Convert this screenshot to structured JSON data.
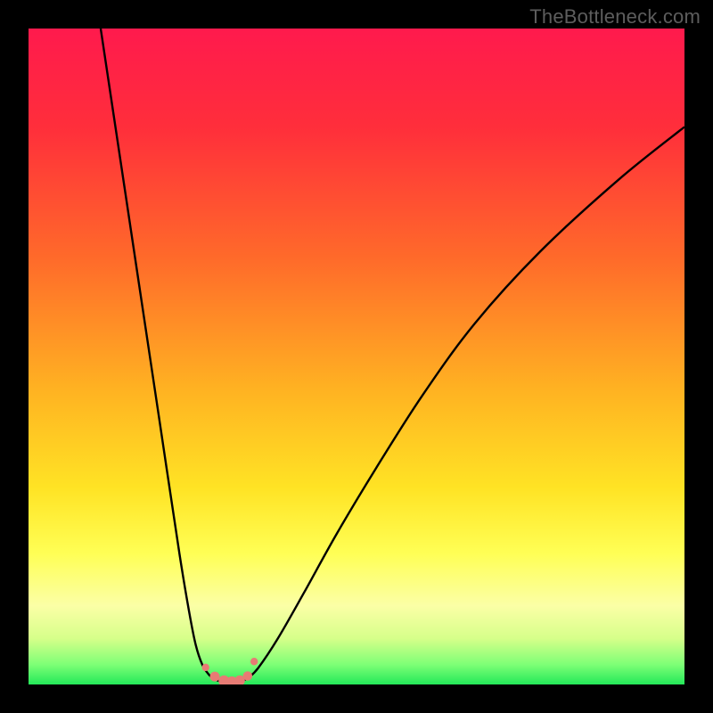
{
  "watermark": "TheBottleneck.com",
  "colors": {
    "frame": "#000000",
    "gradient_stops": [
      {
        "offset": 0.0,
        "color": "#ff1a4d"
      },
      {
        "offset": 0.15,
        "color": "#ff2e3b"
      },
      {
        "offset": 0.35,
        "color": "#ff6a2a"
      },
      {
        "offset": 0.55,
        "color": "#ffb222"
      },
      {
        "offset": 0.7,
        "color": "#ffe324"
      },
      {
        "offset": 0.8,
        "color": "#ffff55"
      },
      {
        "offset": 0.88,
        "color": "#fbffa6"
      },
      {
        "offset": 0.93,
        "color": "#d6ff8a"
      },
      {
        "offset": 0.97,
        "color": "#7dff76"
      },
      {
        "offset": 1.0,
        "color": "#24e859"
      }
    ],
    "curve": "#000000",
    "marker_fill": "#e77b74",
    "marker_stroke": "#d9645c"
  },
  "chart_data": {
    "type": "line",
    "title": "",
    "xlabel": "",
    "ylabel": "",
    "xlim": [
      0,
      100
    ],
    "ylim": [
      0,
      100
    ],
    "series": [
      {
        "name": "left-branch",
        "x": [
          11,
          14,
          17,
          20,
          23,
          24.5,
          25.5,
          26.5,
          27.5,
          28.3
        ],
        "y": [
          100,
          80,
          60,
          40,
          20,
          11,
          6,
          3,
          1.5,
          0.8
        ]
      },
      {
        "name": "valley",
        "x": [
          28.3,
          29.5,
          30.5,
          31.5,
          32.5,
          33.5
        ],
        "y": [
          0.8,
          0.4,
          0.3,
          0.3,
          0.5,
          1.0
        ]
      },
      {
        "name": "right-branch",
        "x": [
          33.5,
          35,
          38,
          42,
          47,
          53,
          60,
          68,
          78,
          90,
          100
        ],
        "y": [
          1.0,
          2.5,
          7,
          14,
          23,
          33,
          44,
          55,
          66,
          77,
          85
        ]
      }
    ],
    "markers": {
      "name": "valley-markers",
      "points": [
        {
          "x": 27.0,
          "y": 2.6,
          "r": 4.2
        },
        {
          "x": 28.4,
          "y": 1.2,
          "r": 5.5
        },
        {
          "x": 29.8,
          "y": 0.55,
          "r": 6.2
        },
        {
          "x": 31.0,
          "y": 0.4,
          "r": 6.2
        },
        {
          "x": 32.2,
          "y": 0.6,
          "r": 5.8
        },
        {
          "x": 33.4,
          "y": 1.3,
          "r": 5.2
        },
        {
          "x": 34.4,
          "y": 3.5,
          "r": 4.2
        }
      ]
    }
  }
}
